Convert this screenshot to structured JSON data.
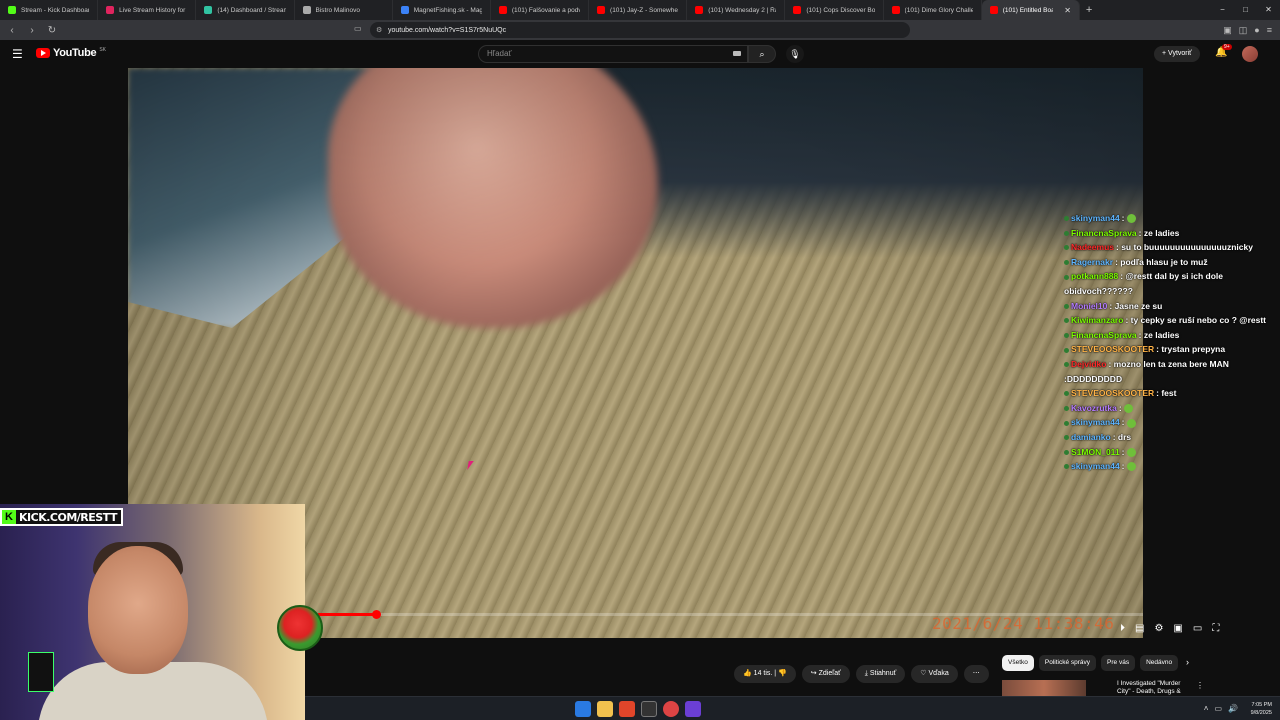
{
  "browser": {
    "tabs": [
      {
        "title": "Stream - Kick Dashboard",
        "color": "#53fc18"
      },
      {
        "title": "Live Stream History for Blerp S",
        "color": "#e0245e"
      },
      {
        "title": "(14) Dashboard / Streamlabs",
        "color": "#31c3a2"
      },
      {
        "title": "Bistro Malinovo",
        "color": "#aaaaaa"
      },
      {
        "title": "MagnetFishing.sk - Magnety",
        "color": "#3b82f6"
      },
      {
        "title": "(101) Falšovanie a podvody s tr",
        "color": "#ff0000"
      },
      {
        "title": "(101) Jay-Z - SomewhereInAm",
        "color": "#ff0000"
      },
      {
        "title": "(101) Wednesday 2 | Řádí tam",
        "color": "#ff0000"
      },
      {
        "title": "(101) Cops Discover Bodies in",
        "color": "#ff0000"
      },
      {
        "title": "(101) Dime Glory Challenge 2",
        "color": "#ff0000"
      },
      {
        "title": "(101) Entitled Boaters",
        "color": "#ff0000",
        "active": true
      }
    ],
    "url": "youtube.com/watch?v=S1S7r5NuUQc",
    "new_tab": "+",
    "window_controls": [
      "−",
      "□",
      "✕"
    ]
  },
  "youtube": {
    "logo_text": "YouTube",
    "logo_country": "SK",
    "search_placeholder": "Hľadať",
    "create_label": "+ Vytvoriť",
    "notifications": "9+"
  },
  "player": {
    "timestamp_overlay": "2021/6/24  11:38:46",
    "progress_fraction": 0.07
  },
  "chat": [
    {
      "user": "skinyman44",
      "color": "#5fb6ff",
      "text": "",
      "emote": true
    },
    {
      "user": "FinancnaSprava",
      "color": "#7CFC00",
      "text": "ze ladies"
    },
    {
      "user": "Nadeemus",
      "color": "#ff2a2a",
      "text": "su to buuuuuuuuuuuuuuuznicky"
    },
    {
      "user": "Ragernakr",
      "color": "#5fb6ff",
      "text": "podľa hlasu je to muž"
    },
    {
      "user": "potkann888",
      "color": "#7CFC00",
      "text": "@restt dal by si ich dole obidvoch??????"
    },
    {
      "user": "Moniel10",
      "color": "#b57cff",
      "text": "Jasne ze su"
    },
    {
      "user": "Kiwimanzaro",
      "color": "#7CFC00",
      "text": "ty cepky se ruší nebo co ? @restt"
    },
    {
      "user": "FinancnaSprava",
      "color": "#7CFC00",
      "text": "ze ladies"
    },
    {
      "user": "STEVEOOSKOOTER",
      "color": "#ffb347",
      "text": "trystan prepyna"
    },
    {
      "user": "Dejvidko",
      "color": "#ff2a2a",
      "text": "mozno len ta zena bere MAN :DDDDDDDDD"
    },
    {
      "user": "STEVEOOSKOOTER",
      "color": "#ffb347",
      "text": "fest"
    },
    {
      "user": "Kavozrutka",
      "color": "#b57cff",
      "text": "",
      "emote": true
    },
    {
      "user": "skinyman44",
      "color": "#5fb6ff",
      "text": "",
      "emote": true
    },
    {
      "user": "damianko",
      "color": "#5fb6ff",
      "text": "drs"
    },
    {
      "user": "S1MON_011",
      "color": "#7CFC00",
      "text": "",
      "emote": true
    },
    {
      "user": "skinyman44",
      "color": "#5fb6ff",
      "text": "",
      "emote": true
    }
  ],
  "webcam": {
    "kick_badge": "KICK.COM/RESTT"
  },
  "actions": {
    "likes": "14 tis.",
    "share": "Zdieľať",
    "download": "Stiahnuť",
    "thanks": "Vďaka",
    "more": "⋯"
  },
  "chips": [
    {
      "label": "Všetko",
      "active": true
    },
    {
      "label": "Politické správy"
    },
    {
      "label": "Pre vás"
    },
    {
      "label": "Nedávno"
    }
  ],
  "recommendation": {
    "title": "I Investigated \"Murder City\" - Death, Drugs & Serial Killers"
  },
  "taskbar": {
    "time": "7:05 PM",
    "date": "9/8/2025"
  }
}
